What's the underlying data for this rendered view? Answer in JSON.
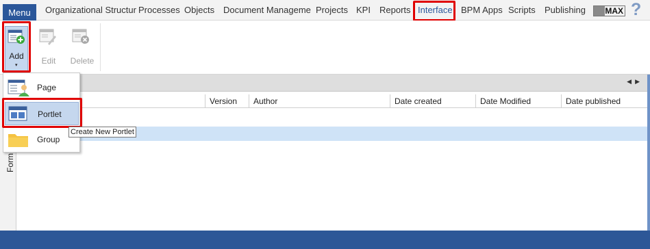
{
  "topbar": {
    "menu_label": "Menu",
    "tabs": [
      {
        "label": "Organizational Structur"
      },
      {
        "label": "Processes"
      },
      {
        "label": "Objects"
      },
      {
        "label": "Document Manageme"
      },
      {
        "label": "Projects"
      },
      {
        "label": "KPI"
      },
      {
        "label": "Reports"
      },
      {
        "label": "Interface"
      },
      {
        "label": "BPM Apps"
      },
      {
        "label": "Scripts"
      },
      {
        "label": "Publishing"
      }
    ],
    "active_tab": "Interface",
    "max_label": "MAX",
    "help_glyph": "?"
  },
  "ribbon": {
    "add_label": "Add",
    "edit_label": "Edit",
    "delete_label": "Delete",
    "caret": "▾"
  },
  "strip": {
    "nav_arrows": "◀▶"
  },
  "grid": {
    "columns": [
      "Version",
      "Author",
      "Date created",
      "Date Modified",
      "Date published"
    ]
  },
  "side_label": "Form",
  "dropdown": {
    "items": [
      {
        "label": "Page",
        "icon": "page-icon"
      },
      {
        "label": "Portlet",
        "icon": "portlet-icon"
      },
      {
        "label": "Group",
        "icon": "folder-icon"
      }
    ],
    "hovered": "Portlet"
  },
  "tooltip": "Create New Portlet",
  "colors": {
    "accent": "#2b579a",
    "highlight": "#e00000",
    "selection": "#cfe3f7"
  }
}
